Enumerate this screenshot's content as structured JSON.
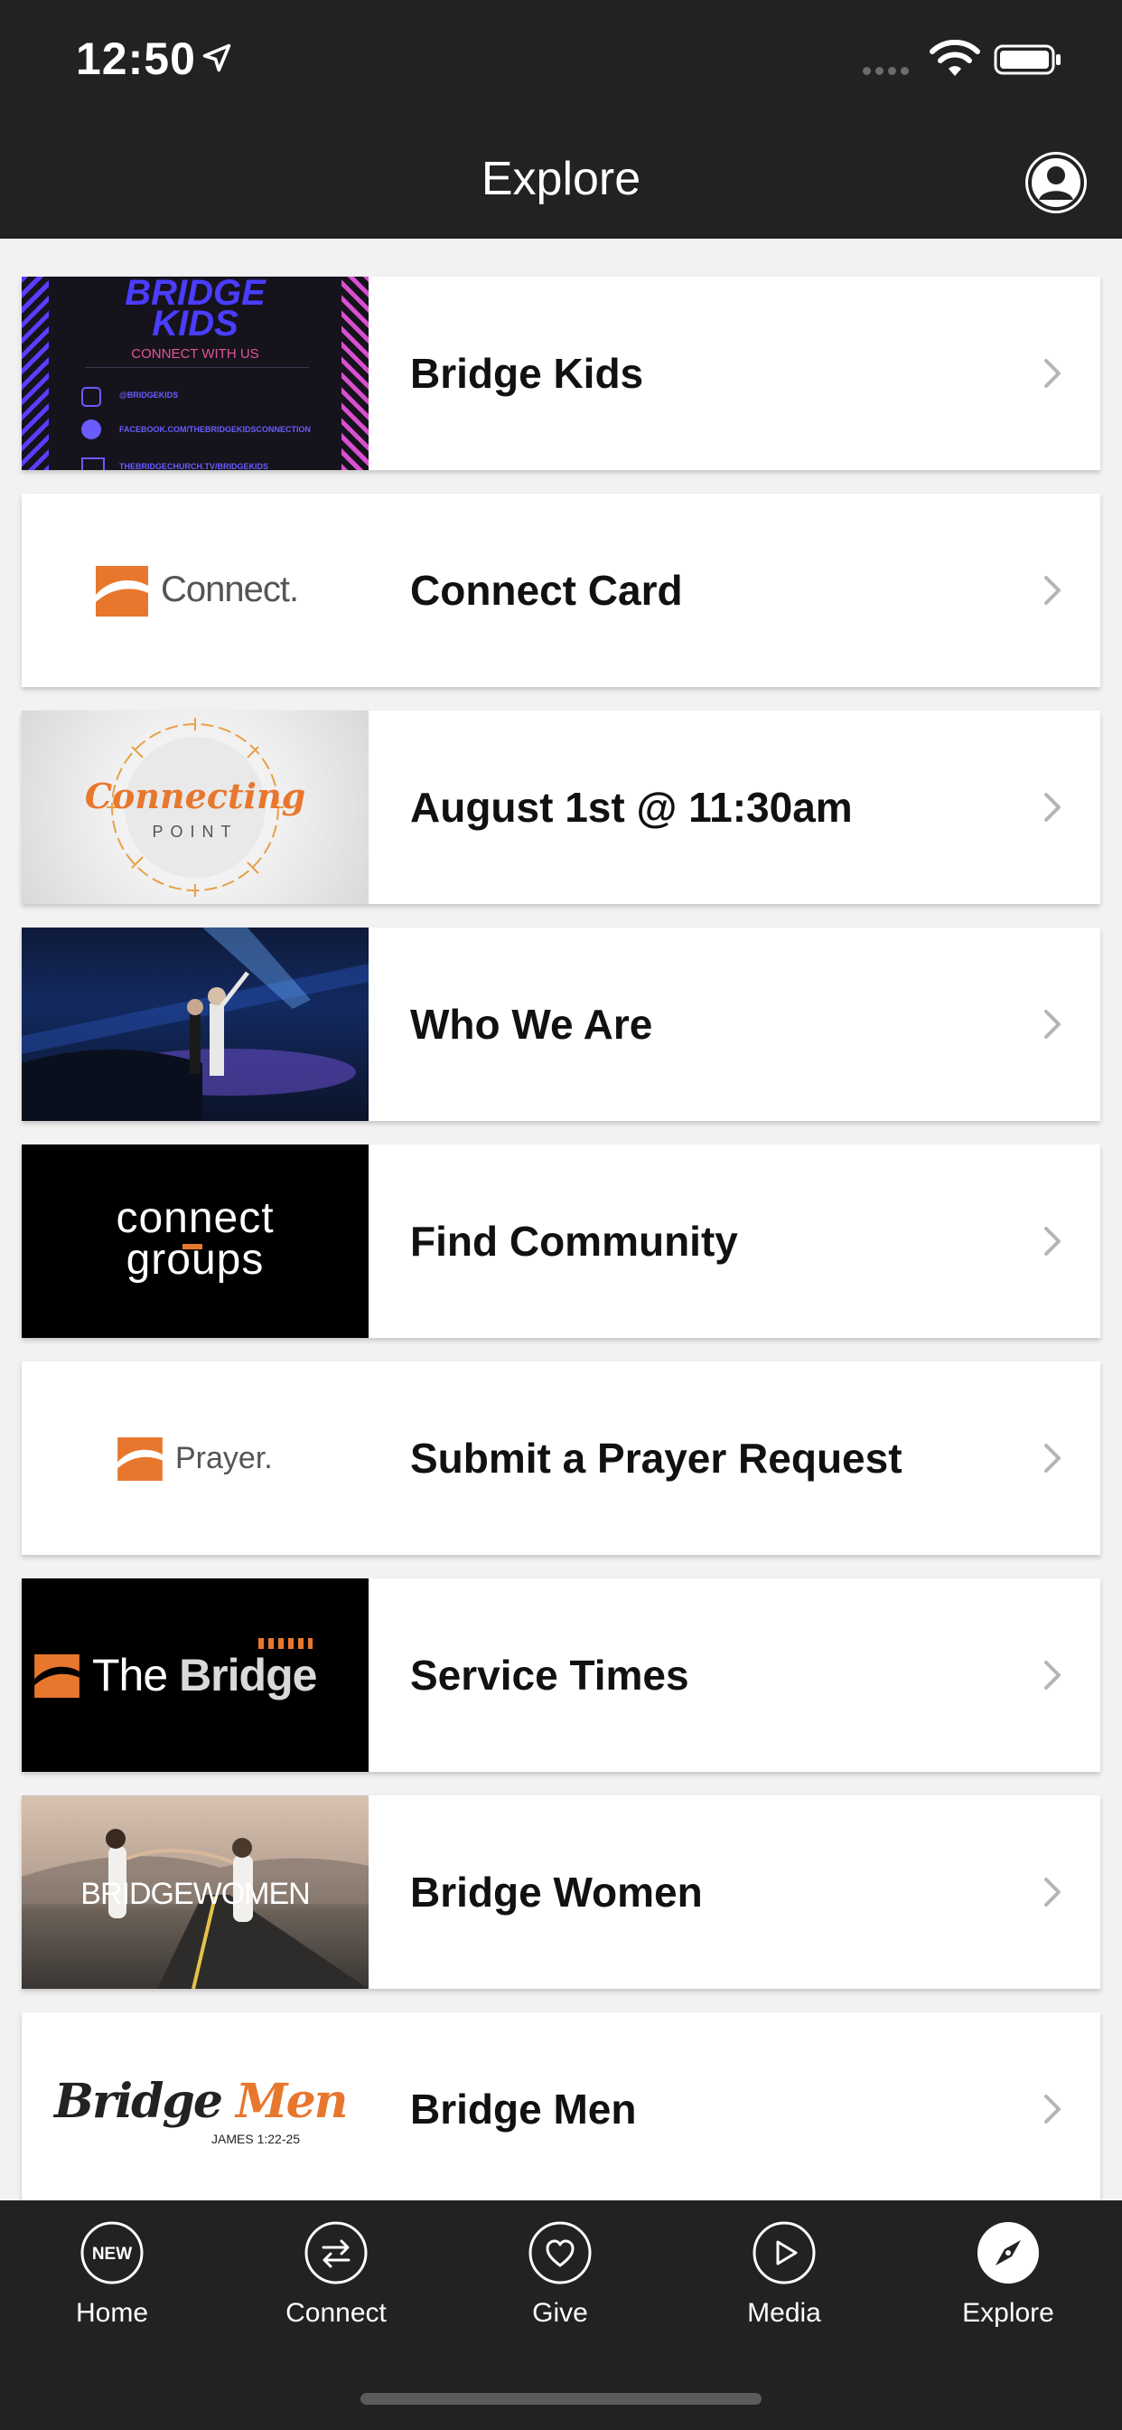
{
  "status_bar": {
    "time": "12:50"
  },
  "nav": {
    "title": "Explore"
  },
  "items": [
    {
      "label": "Bridge Kids",
      "thumb": {
        "line1": "BRIDGE",
        "line2": "KIDS",
        "sub": "CONNECT WITH US",
        "social1": "@BRIDGEKIDS",
        "social2": "FACEBOOK.COM/THEBRIDGEKIDSCONNECTION",
        "social3": "THEBRIDGECHURCH.TV/BRIDGEKIDS"
      }
    },
    {
      "label": "Connect Card",
      "thumb": {
        "text": "Connect."
      }
    },
    {
      "label": "August 1st @ 11:30am",
      "thumb": {
        "script": "Connecting",
        "sub": "POINT"
      }
    },
    {
      "label": "Who We Are",
      "thumb": {}
    },
    {
      "label": "Find Community",
      "thumb": {
        "line1": "connect",
        "line2": "groups"
      }
    },
    {
      "label": "Submit a Prayer Request",
      "thumb": {
        "text": "Prayer."
      }
    },
    {
      "label": "Service Times",
      "thumb": {
        "text_a": "The ",
        "text_b": "Bridge"
      }
    },
    {
      "label": "Bridge Women",
      "thumb": {
        "text": "BRIDGEWOMEN"
      }
    },
    {
      "label": "Bridge Men",
      "thumb": {
        "word1": "Bridge",
        "word2": "Men",
        "verse": "JAMES 1:22-25"
      }
    }
  ],
  "tabs": [
    {
      "label": "Home",
      "icon": "new-badge-icon",
      "badge": "NEW"
    },
    {
      "label": "Connect",
      "icon": "swap-arrows-icon"
    },
    {
      "label": "Give",
      "icon": "heart-icon"
    },
    {
      "label": "Media",
      "icon": "play-icon"
    },
    {
      "label": "Explore",
      "icon": "compass-icon",
      "active": true
    }
  ],
  "colors": {
    "bar": "#222222",
    "accent_orange": "#e8772e",
    "kids_blue": "#4a3dff"
  }
}
